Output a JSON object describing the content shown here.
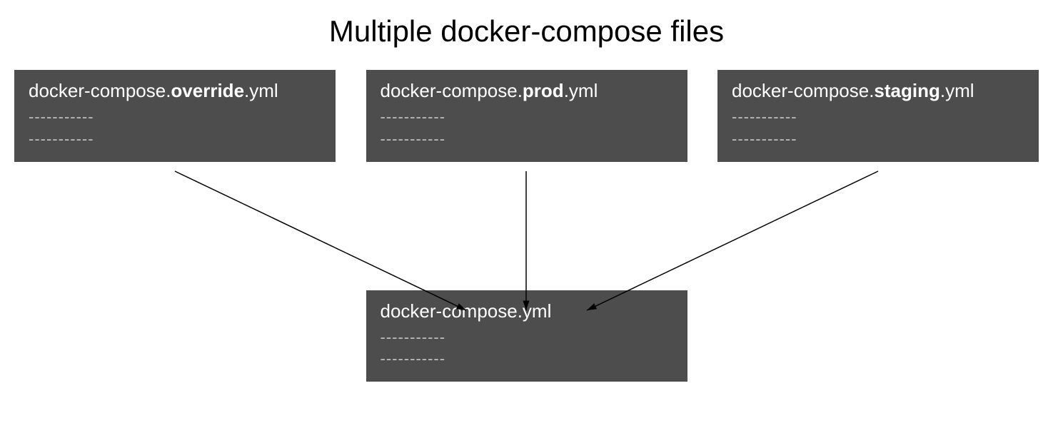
{
  "title": "Multiple docker-compose files",
  "topFiles": [
    {
      "prefix": "docker-compose.",
      "bold": "override",
      "suffix": ".yml",
      "dashes1": "-----------",
      "dashes2": "-----------"
    },
    {
      "prefix": "docker-compose.",
      "bold": "prod",
      "suffix": ".yml",
      "dashes1": "-----------",
      "dashes2": "-----------"
    },
    {
      "prefix": "docker-compose.",
      "bold": "staging",
      "suffix": ".yml",
      "dashes1": "-----------",
      "dashes2": "-----------"
    }
  ],
  "bottomFile": {
    "name": "docker-compose.yml",
    "dashes1": "-----------",
    "dashes2": "-----------"
  }
}
